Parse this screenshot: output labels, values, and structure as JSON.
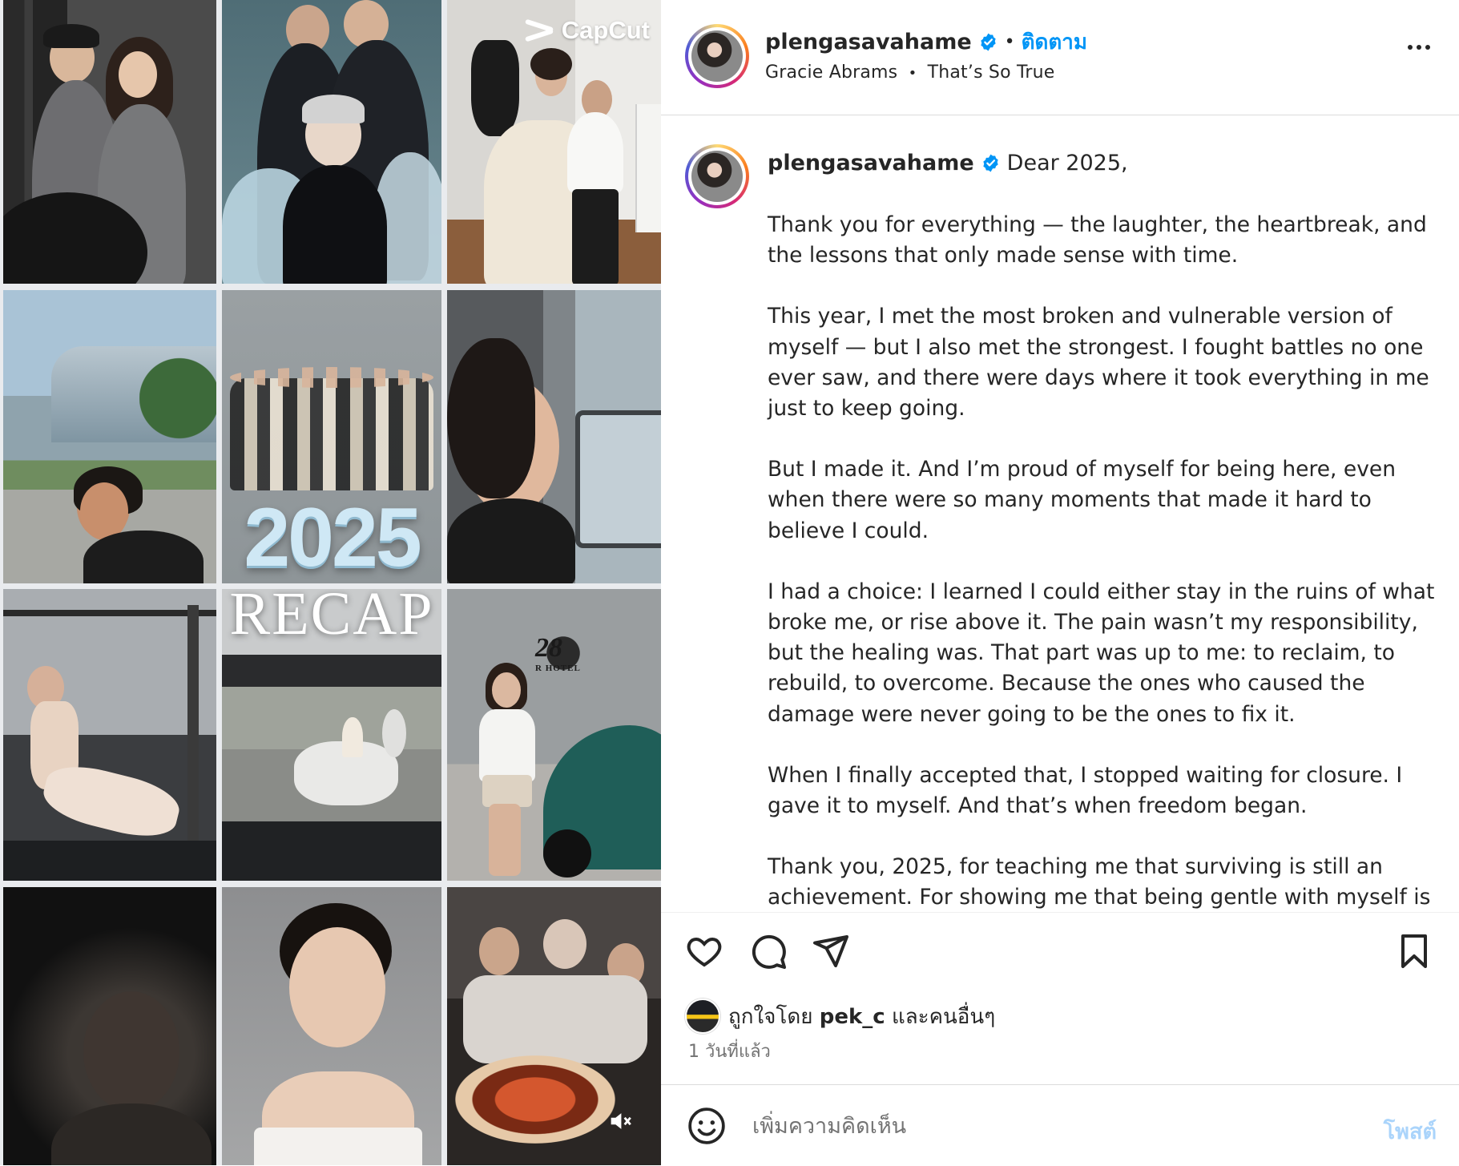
{
  "media": {
    "watermark": "CapCut",
    "title_year": "2025",
    "title_word": "RECAP",
    "hotel_logo_text": "28",
    "hotel_logo_sub": "R HOTEL"
  },
  "header": {
    "username": "plengasavahame",
    "follow_label": "ติดตาม",
    "dot": "•",
    "audio_artist": "Gracie Abrams",
    "audio_track": "That’s So True"
  },
  "caption": {
    "username": "plengasavahame",
    "first_line": "Dear 2025,",
    "paragraphs": [
      "Thank you for everything — the laughter, the heartbreak, and the lessons that only made sense with time.",
      "This year, I met the most broken and vulnerable version of myself — but I also met the strongest. I fought battles no one ever saw, and there were days where it took everything in me just to keep going.",
      "But I made it. And I’m proud of myself for being here, even when there were so many moments that made it hard to believe I could.",
      "I had a choice: I learned I could either stay in the ruins of what broke me, or rise above it. The pain wasn’t my responsibility, but the healing was. That part was up to me: to reclaim, to rebuild, to overcome. Because the ones who caused the damage were never going to be the ones to fix it.",
      "When I finally accepted that, I stopped waiting for closure. I gave it to myself. And that’s when freedom began.",
      "Thank you, 2025, for teaching me that surviving is still an achievement. For showing me that being gentle with myself is"
    ]
  },
  "likes": {
    "prefix": "ถูกใจโดย",
    "user": "pek_c",
    "suffix": "และคนอื่นๆ"
  },
  "time_ago": "1 วันที่แล้ว",
  "comment": {
    "placeholder": "เพิ่มความคิดเห็น",
    "post_label": "โพสต์"
  },
  "colors": {
    "verified": "#0095f6",
    "follow": "#0095f6",
    "post_disabled": "#aad4fb",
    "year_text": "#cfe8f5"
  },
  "icons": [
    "verified-icon",
    "more-icon",
    "heart-icon",
    "comment-icon",
    "share-icon",
    "bookmark-icon",
    "emoji-icon",
    "mute-icon"
  ]
}
